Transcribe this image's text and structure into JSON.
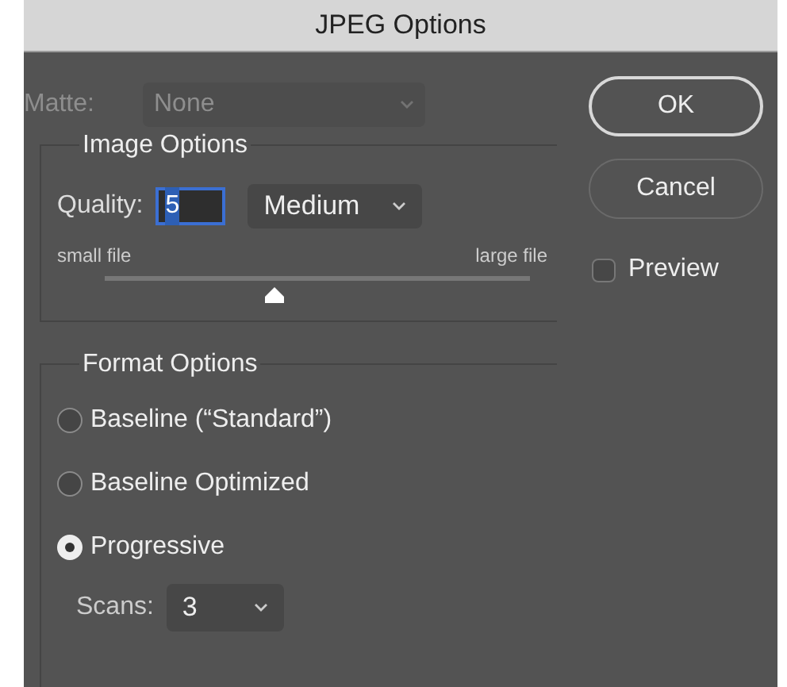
{
  "window": {
    "title": "JPEG Options"
  },
  "matte": {
    "label": "Matte:",
    "value": "None",
    "disabled": true
  },
  "image_options": {
    "title": "Image Options",
    "quality_label": "Quality:",
    "quality_value": "5",
    "quality_preset": "Medium",
    "small_label": "small file",
    "large_label": "large file",
    "level": 0.4
  },
  "format_options": {
    "title": "Format Options",
    "options": [
      {
        "label": "Baseline (“Standard”)",
        "selected": false
      },
      {
        "label": "Baseline Optimized",
        "selected": false
      },
      {
        "label": "Progressive",
        "selected": true
      }
    ],
    "scans_label": "Scans:",
    "scans_value": "3"
  },
  "buttons": [
    {
      "label": "OK",
      "default": true
    },
    {
      "label": "Cancel",
      "default": false
    }
  ],
  "preview": {
    "label": "Preview",
    "checked": false
  }
}
